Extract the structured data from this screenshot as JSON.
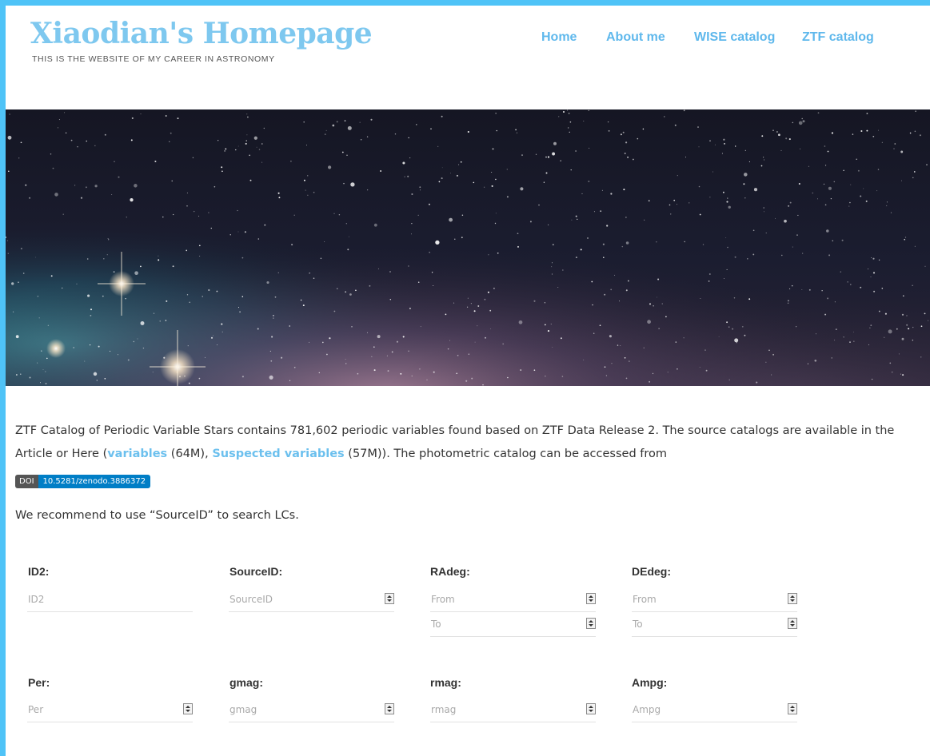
{
  "site": {
    "title": "Xiaodian's Homepage",
    "tagline": "THIS IS THE WEBSITE OF MY CAREER IN ASTRONOMY"
  },
  "nav": {
    "items": [
      {
        "label": "Home"
      },
      {
        "label": "About me"
      },
      {
        "label": "WISE catalog"
      },
      {
        "label": "ZTF catalog"
      }
    ]
  },
  "hero": {
    "image": "starry-night-sky-banner"
  },
  "intro": {
    "text1": "ZTF Catalog of Periodic Variable Stars contains 781,602 periodic variables found based on ZTF Data Release 2. The source catalogs are available in the Article or Here (",
    "link1": "variables",
    "text2": " (64M), ",
    "link2": "Suspected variables",
    "text3": " (57M)). The photometric catalog can be accessed from"
  },
  "doi": {
    "label": "DOI",
    "value": "10.5281/zenodo.3886372"
  },
  "recommend": "We recommend to use “SourceID” to search LCs.",
  "search": {
    "row1": [
      {
        "label": "ID2:",
        "placeholder": "ID2"
      },
      {
        "label": "SourceID:",
        "placeholder": "SourceID"
      },
      {
        "label": "RAdeg:",
        "from": "From",
        "to": "To"
      },
      {
        "label": "DEdeg:",
        "from": "From",
        "to": "To"
      }
    ],
    "row2": [
      {
        "label": "Per:",
        "placeholder": "Per"
      },
      {
        "label": "gmag:",
        "placeholder": "gmag"
      },
      {
        "label": "rmag:",
        "placeholder": "rmag"
      },
      {
        "label": "Ampg:",
        "placeholder": "Ampg"
      }
    ]
  },
  "colors": {
    "accent": "#4fc3f7",
    "title": "#7ec8ef",
    "link": "#6cc0ee",
    "doi": "#007ec6"
  }
}
